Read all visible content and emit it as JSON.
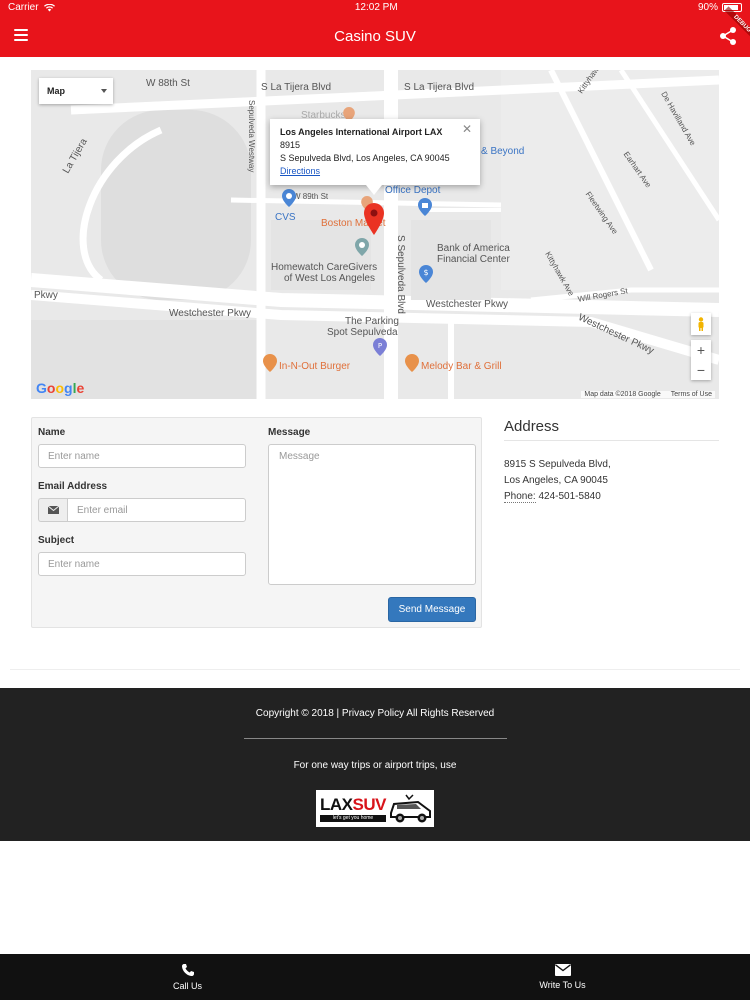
{
  "status_bar": {
    "carrier": "Carrier",
    "time": "12:02 PM",
    "battery": "90%",
    "battery_level": 0.9
  },
  "app_bar": {
    "title": "Casino SUV",
    "debug_label": "DEBUG"
  },
  "map": {
    "type_selector": "Map",
    "info_window": {
      "title": "Los Angeles International Airport LAX",
      "line1": "8915",
      "line2": "S Sepulveda Blvd, Los Angeles, CA 90045",
      "directions": "Directions"
    },
    "labels": {
      "w88th": "W 88th St",
      "la_tijera_blvd_1": "S La Tijera Blvd",
      "la_tijera_blvd_2": "S La Tijera Blvd",
      "starbucks": "Starbucks",
      "la_tijera": "La Tijera",
      "sepulveda_westway": "Sepulveda Westway",
      "beyond": "& Beyond",
      "office_depot": "Office Depot",
      "w89th": "W 89th St",
      "cvs": "CVS",
      "boston_market": "Boston Market",
      "bank_of_america_1": "Bank of America",
      "bank_of_america_2": "Financial Center",
      "homewatch_1": "Homewatch CareGivers",
      "homewatch_2": "of West Los Angeles",
      "s_sepulveda_blvd": "S Sepulveda Blvd",
      "pkwy": "Pkwy",
      "westchester_pkwy_1": "Westchester Pkwy",
      "westchester_pkwy_2": "Westchester Pkwy",
      "westchester_pkwy_3": "Westchester Pkwy",
      "parking_1": "The Parking",
      "parking_2": "Spot Sepulveda",
      "in_n_out": "In-N-Out Burger",
      "melody": "Melody Bar & Grill",
      "will_rogers": "Will Rogers St",
      "kittyhawk_1": "Kittyhawk Ave",
      "kittyhawk_2": "Kittyhawk Ave",
      "earhart": "Earhart Ave",
      "fleetwing": "Fleetwing Ave",
      "de_havilland": "De Havilland Ave"
    },
    "zoom_in": "+",
    "zoom_out": "−",
    "google": [
      "G",
      "o",
      "o",
      "g",
      "l",
      "e"
    ],
    "map_data": "Map data ©2018 Google",
    "terms": "Terms of Use"
  },
  "form": {
    "name_label": "Name",
    "name_placeholder": "Enter name",
    "email_label": "Email Address",
    "email_placeholder": "Enter email",
    "subject_label": "Subject",
    "subject_placeholder": "Enter name",
    "message_label": "Message",
    "message_placeholder": "Message",
    "send_label": "Send Message"
  },
  "address": {
    "heading": "Address",
    "line1": "8915 S Sepulveda Blvd,",
    "line2": "Los Angeles, CA 90045",
    "phone_label": "Phone:",
    "phone": "424-501-5840"
  },
  "footer": {
    "copyright": "Copyright © 2018 | Privacy Policy All Rights Reserved",
    "one_way": "For one way trips or airport trips, use",
    "logo_lax": "LAX",
    "logo_suv": "SUV",
    "logo_tagline": "let's get you home"
  },
  "tabs": [
    {
      "label": "Call Us",
      "icon": "phone-icon"
    },
    {
      "label": "Write To Us",
      "icon": "envelope-icon"
    }
  ],
  "colors": {
    "brand_red": "#e8141b",
    "button_blue": "#3478bd",
    "footer_bg": "#222222",
    "tabbar_bg": "#111111"
  }
}
